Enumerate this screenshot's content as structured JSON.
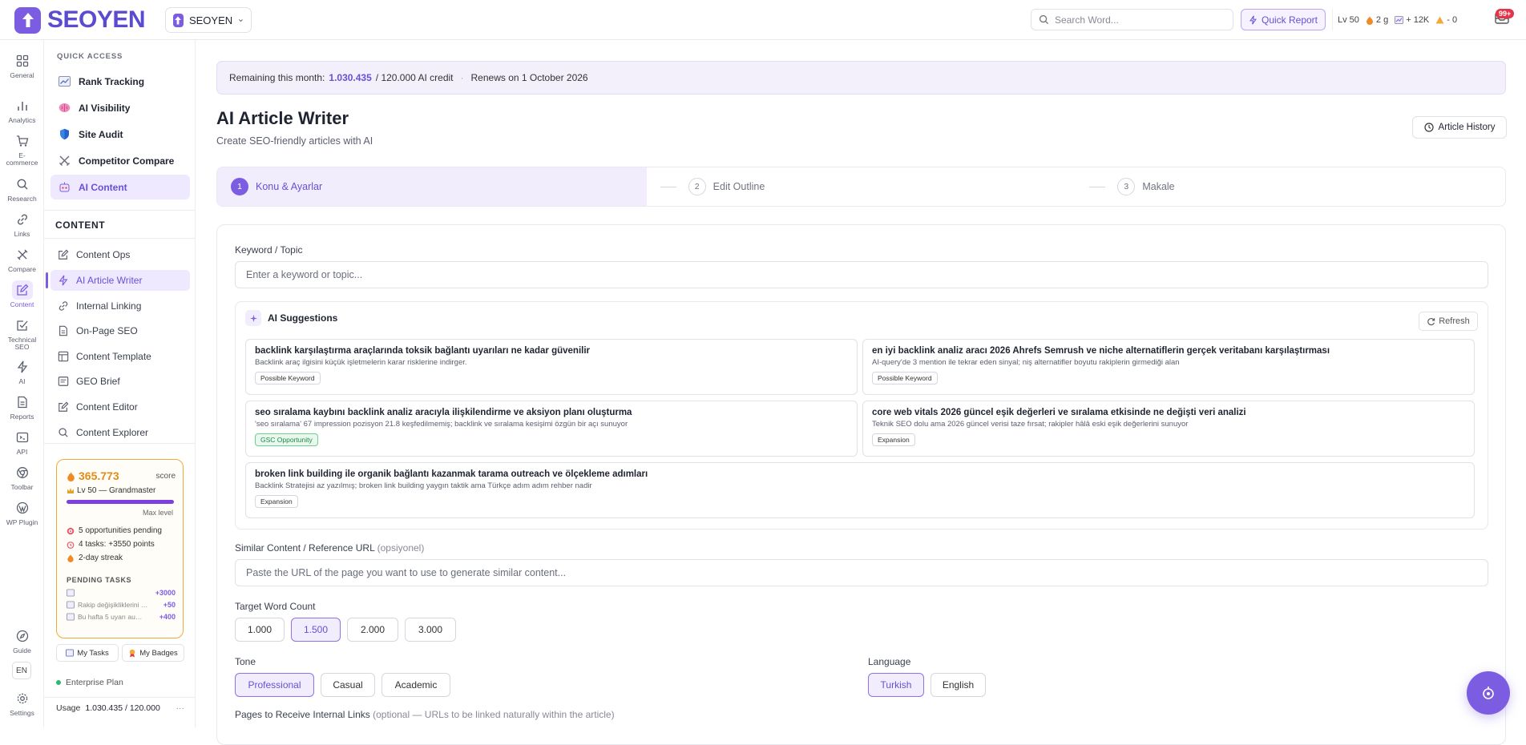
{
  "brand": {
    "name": "SEOYEN",
    "accent": "#7c5ce0"
  },
  "workspace": {
    "label": "SEOYEN"
  },
  "search": {
    "placeholder": "Search Word..."
  },
  "topbar": {
    "quick_report": "Quick Report",
    "level": "Lv 50",
    "streak": "2 g",
    "points": "+ 12K",
    "alerts": "- 0",
    "notifications": "99+"
  },
  "rail": [
    {
      "label": "General",
      "icon": "grid-icon"
    },
    {
      "label": "Analytics",
      "icon": "bar-chart-icon"
    },
    {
      "label": "E-commerce",
      "icon": "cart-icon"
    },
    {
      "label": "Research",
      "icon": "search-icon"
    },
    {
      "label": "Links",
      "icon": "link-icon"
    },
    {
      "label": "Compare",
      "icon": "scale-icon"
    },
    {
      "label": "Content",
      "icon": "edit-icon"
    },
    {
      "label": "Technical SEO",
      "icon": "checklist-icon"
    },
    {
      "label": "AI",
      "icon": "bolt-icon"
    },
    {
      "label": "Reports",
      "icon": "report-icon"
    },
    {
      "label": "API",
      "icon": "api-icon"
    },
    {
      "label": "Toolbar",
      "icon": "chrome-icon"
    },
    {
      "label": "WP Plugin",
      "icon": "wordpress-icon"
    }
  ],
  "rail_bottom": {
    "guide": "Guide",
    "lang": "EN",
    "settings": "Settings"
  },
  "quick_access": {
    "heading": "QUICK ACCESS",
    "items": [
      {
        "label": "Rank Tracking",
        "icon": "chart-icon"
      },
      {
        "label": "AI Visibility",
        "icon": "brain-icon"
      },
      {
        "label": "Site Audit",
        "icon": "shield-icon"
      },
      {
        "label": "Competitor Compare",
        "icon": "swords-icon"
      },
      {
        "label": "AI Content",
        "icon": "robot-icon"
      }
    ]
  },
  "content_section": {
    "heading": "CONTENT",
    "items": [
      {
        "label": "Content Ops",
        "icon": "edit-icon"
      },
      {
        "label": "AI Article Writer",
        "icon": "bolt-icon"
      },
      {
        "label": "Internal Linking",
        "icon": "link-icon"
      },
      {
        "label": "On-Page SEO",
        "icon": "document-icon"
      },
      {
        "label": "Content Template",
        "icon": "template-icon"
      },
      {
        "label": "GEO Brief",
        "icon": "globe-icon"
      },
      {
        "label": "Content Editor",
        "icon": "edit-icon"
      },
      {
        "label": "Content Explorer",
        "icon": "search-icon"
      }
    ]
  },
  "score_card": {
    "score": "365.773",
    "score_label": "score",
    "level": "Lv 50 — Grandmaster",
    "progress": 1.0,
    "max_label": "Max level",
    "lines": [
      "5 opportunities pending",
      "4 tasks: +3550 points",
      "2-day streak"
    ],
    "pending_heading": "PENDING TASKS",
    "tasks": [
      {
        "name": "",
        "points": "+3000"
      },
      {
        "name": "Rakip değişikliklerini …",
        "points": "+50"
      },
      {
        "name": "Bu hafta 5 uyarı au…",
        "points": "+400"
      }
    ],
    "my_tasks": "My Tasks",
    "my_badges": "My Badges"
  },
  "plan": {
    "label": "Enterprise Plan"
  },
  "usage": {
    "label": "Usage",
    "value": "1.030.435 / 120.000",
    "more": "···"
  },
  "credit": {
    "prefix": "Remaining this month:",
    "used": "1.030.435",
    "rest": "/ 120.000 AI credit",
    "sep": "·",
    "renews": "Renews on 1 October 2026"
  },
  "page": {
    "title": "AI Article Writer",
    "subtitle": "Create SEO-friendly articles with AI",
    "history_btn": "Article History"
  },
  "steps": [
    {
      "num": "1",
      "label": "Konu & Ayarlar"
    },
    {
      "num": "2",
      "label": "Edit Outline"
    },
    {
      "num": "3",
      "label": "Makale"
    }
  ],
  "form": {
    "keyword_label": "Keyword / Topic",
    "keyword_placeholder": "Enter a keyword or topic...",
    "sugg_heading": "AI Suggestions",
    "refresh": "Refresh",
    "suggestions": [
      {
        "title": "backlink karşılaştırma araçlarında toksik bağlantı uyarıları ne kadar güvenilir",
        "desc": "Backlink araç ilgisini küçük işletmelerin karar risklerine indirger.",
        "tag": "Possible Keyword",
        "tag_type": "plain"
      },
      {
        "title": "en iyi backlink analiz aracı 2026 Ahrefs Semrush ve niche alternatiflerin gerçek veritabanı karşılaştırması",
        "desc": "AI-query'de 3 mention ile tekrar eden sinyal; niş alternatifler boyutu rakiplerin girmediği alan",
        "tag": "Possible Keyword",
        "tag_type": "plain"
      },
      {
        "title": "seo sıralama kaybını backlink analiz aracıyla ilişkilendirme ve aksiyon planı oluşturma",
        "desc": "'seo sıralama' 67 impression pozisyon 21.8 keşfedilmemiş; backlink ve sıralama kesişimi özgün bir açı sunuyor",
        "tag": "GSC Opportunity",
        "tag_type": "gsc"
      },
      {
        "title": "core web vitals 2026 güncel eşik değerleri ve sıralama etkisinde ne değişti veri analizi",
        "desc": "Teknik SEO dolu ama 2026 güncel verisi taze fırsat; rakipler hâlâ eski eşik değerlerini sunuyor",
        "tag": "Expansion",
        "tag_type": "plain"
      },
      {
        "title": "broken link building ile organik bağlantı kazanmak tarama outreach ve ölçekleme adımları",
        "desc": "Backlink Stratejisi az yazılmış; broken link building yaygın taktik ama Türkçe adım adım rehber nadir",
        "tag": "Expansion",
        "tag_type": "plain"
      }
    ],
    "similar_label": "Similar Content / Reference URL",
    "similar_optional": "(opsiyonel)",
    "similar_placeholder": "Paste the URL of the page you want to use to generate similar content...",
    "word_count_label": "Target Word Count",
    "word_counts": [
      "1.000",
      "1.500",
      "2.000",
      "3.000"
    ],
    "word_count_selected": "1.500",
    "tone_label": "Tone",
    "tones": [
      "Professional",
      "Casual",
      "Academic"
    ],
    "tone_selected": "Professional",
    "language_label": "Language",
    "languages": [
      "Turkish",
      "English"
    ],
    "language_selected": "Turkish",
    "internal_links_label": "Pages to Receive Internal Links",
    "internal_links_optional": "(optional — URLs to be linked naturally within the article)"
  }
}
